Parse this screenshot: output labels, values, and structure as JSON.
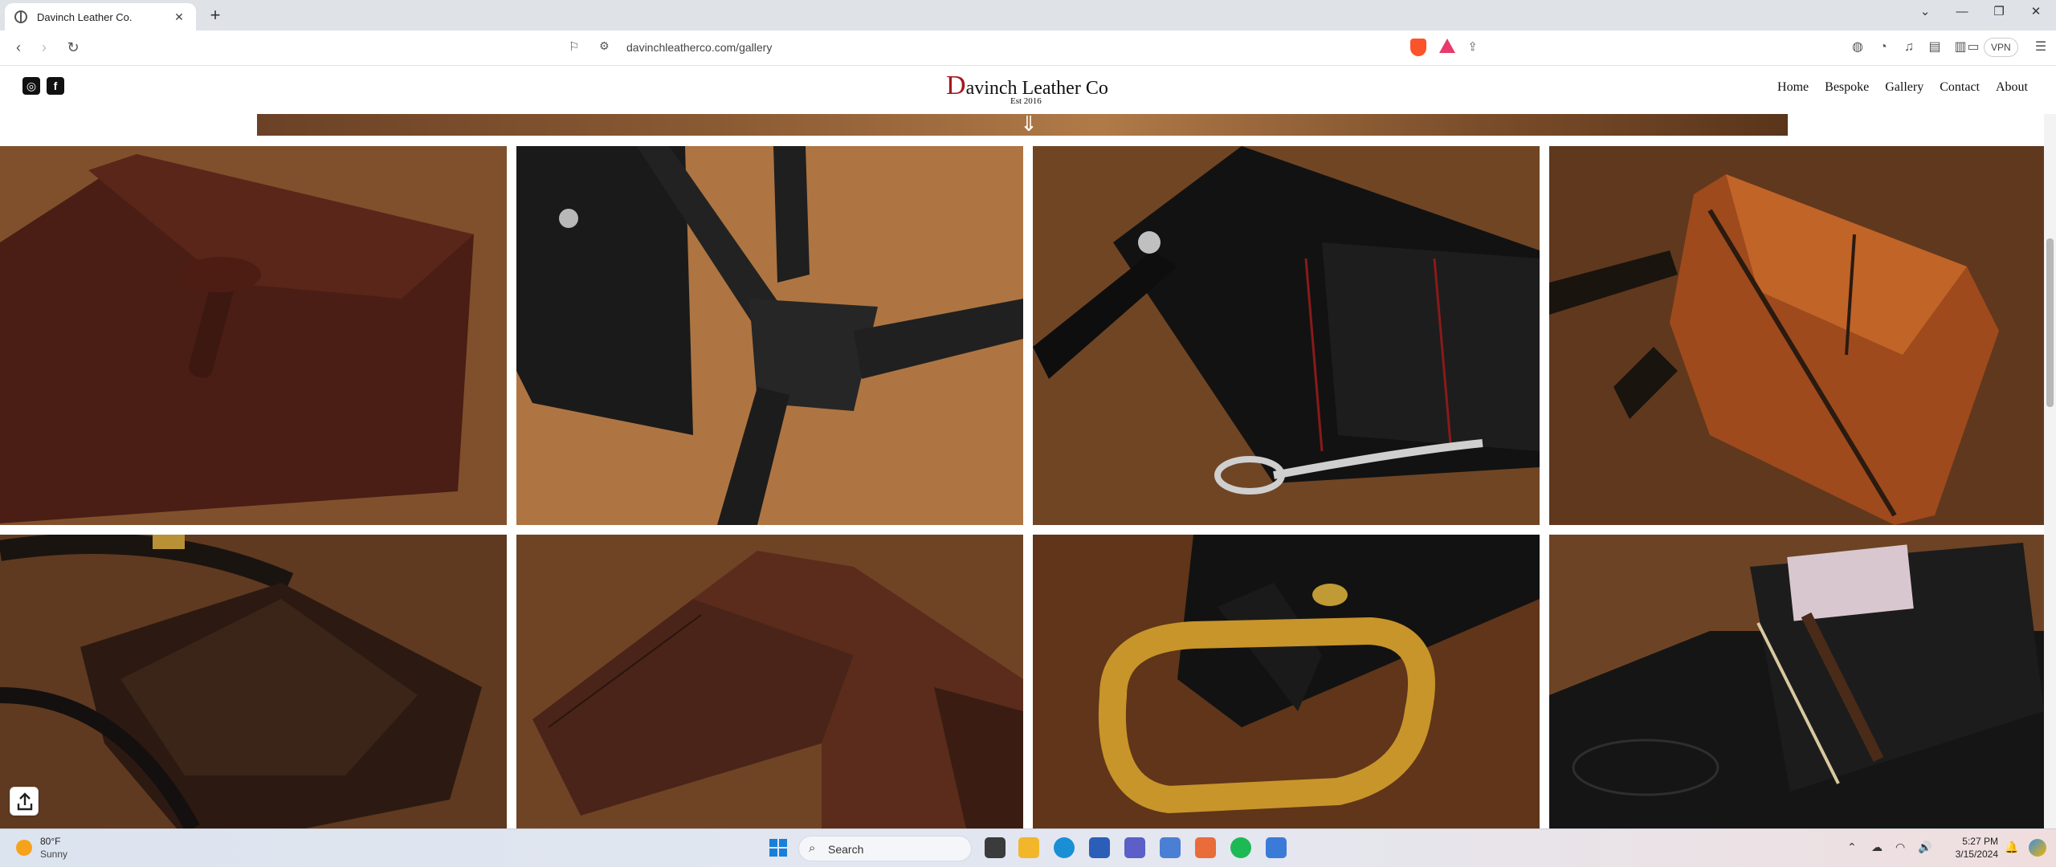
{
  "browser": {
    "tab_title": "Davinch Leather Co.",
    "url": "davinchleatherco.com/gallery",
    "vpn_label": "VPN",
    "accent": "#fb542b"
  },
  "site": {
    "brand_initial": "D",
    "brand_rest": "avinch Leather Co",
    "tagline": "Est 2016",
    "brand_color": "#a3171c",
    "nav": [
      "Home",
      "Bespoke",
      "Gallery",
      "Contact",
      "About"
    ],
    "social": [
      {
        "name": "instagram-icon",
        "glyph": "◎"
      },
      {
        "name": "facebook-icon",
        "glyph": "f"
      }
    ]
  },
  "gallery": {
    "photos": [
      {
        "subject": "brown leather envelope folio",
        "icon": "folio-photo"
      },
      {
        "subject": "black crocodile-embossed holster harness",
        "icon": "holster-photo"
      },
      {
        "subject": "black wallet with red stitching and silver clip",
        "icon": "wallet-chain-photo"
      },
      {
        "subject": "cognac leather sling bag with zipper",
        "icon": "sling-bag-photo"
      },
      {
        "subject": "dark brown leather shoulder bag",
        "icon": "shoulder-bag-photo"
      },
      {
        "subject": "brown bifold wallet with croc panel",
        "icon": "bifold-photo"
      },
      {
        "subject": "black belt with brass buckle",
        "icon": "belt-photo"
      },
      {
        "subject": "black card wallet with stamped logo",
        "icon": "card-wallet-photo"
      }
    ]
  },
  "taskbar": {
    "temperature": "80°F",
    "condition": "Sunny",
    "search_label": "Search",
    "time": "5:27 PM",
    "date": "3/15/2024"
  }
}
